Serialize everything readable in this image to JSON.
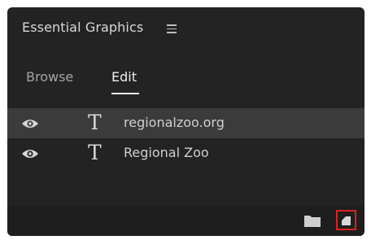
{
  "panel": {
    "title": "Essential Graphics",
    "menu_icon": "hamburger-menu-icon"
  },
  "tabs": [
    {
      "label": "Browse",
      "active": false
    },
    {
      "label": "Edit",
      "active": true
    }
  ],
  "layers": [
    {
      "name": "regionalzoo.org",
      "type_glyph": "T",
      "visible": true,
      "selected": true
    },
    {
      "name": "Regional Zoo",
      "type_glyph": "T",
      "visible": true,
      "selected": false
    }
  ],
  "footer": {
    "folder_icon": "folder-icon",
    "new_item_icon": "new-item-icon"
  },
  "colors": {
    "panel_bg": "#232323",
    "selected_row": "#3b3b3b",
    "footer_bg": "#1e1e1e",
    "highlight_box": "#e02020"
  }
}
